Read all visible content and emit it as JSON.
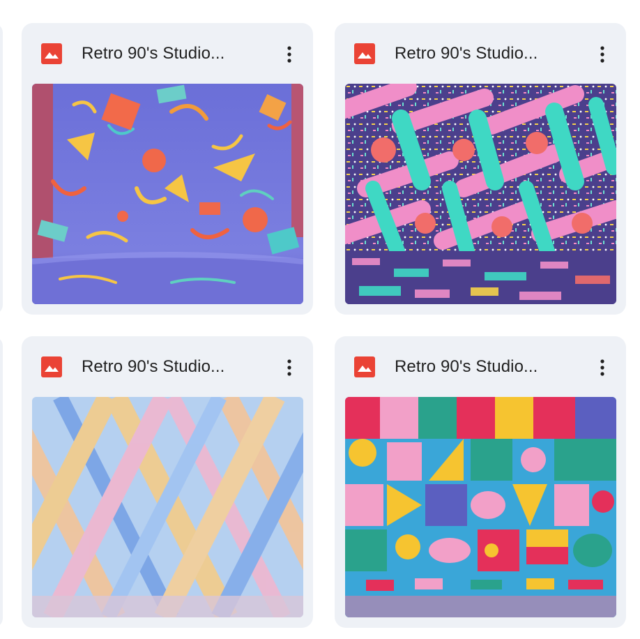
{
  "cards": [
    {
      "title": "Retro 90's Studio...",
      "icon": "image-file-icon",
      "menu_icon": "more-vert-icon",
      "thumbnail": "retro-memphis-purple-squiggles-backdrop"
    },
    {
      "title": "Retro 90's Studio...",
      "icon": "image-file-icon",
      "menu_icon": "more-vert-icon",
      "thumbnail": "retro-memphis-confetti-brushstrokes-room"
    },
    {
      "title": "Retro 90's Studio...",
      "icon": "image-file-icon",
      "menu_icon": "more-vert-icon",
      "thumbnail": "pastel-diagonal-plaid-room"
    },
    {
      "title": "Retro 90's Studio...",
      "icon": "image-file-icon",
      "menu_icon": "more-vert-icon",
      "thumbnail": "bauhaus-geometric-tiles-room"
    }
  ],
  "colors": {
    "card_background": "#eef1f6",
    "icon_red": "#ea4335",
    "title_text": "#1f1f1f"
  }
}
